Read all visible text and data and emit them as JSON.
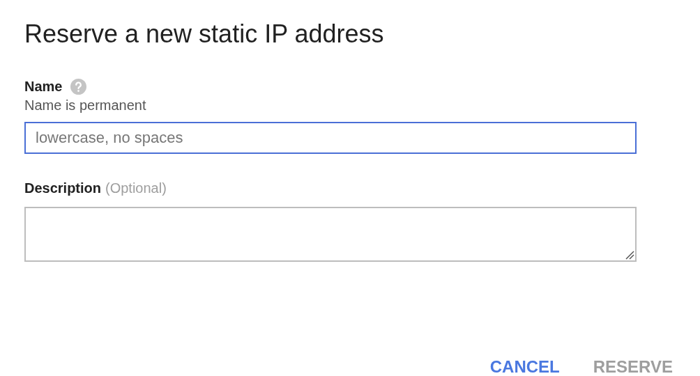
{
  "dialog": {
    "title": "Reserve a new static IP address"
  },
  "fields": [
    {
      "kind": "input",
      "label": "Name",
      "help_icon": true,
      "helper": "Name is permanent",
      "placeholder": "lowercase, no spaces",
      "focused": true
    },
    {
      "kind": "textarea",
      "label": "Description",
      "hint": "(Optional)",
      "focused": false
    }
  ],
  "buttons": [
    {
      "label": "CANCEL",
      "disabled": false
    },
    {
      "label": "RESERVE",
      "disabled": true
    }
  ]
}
